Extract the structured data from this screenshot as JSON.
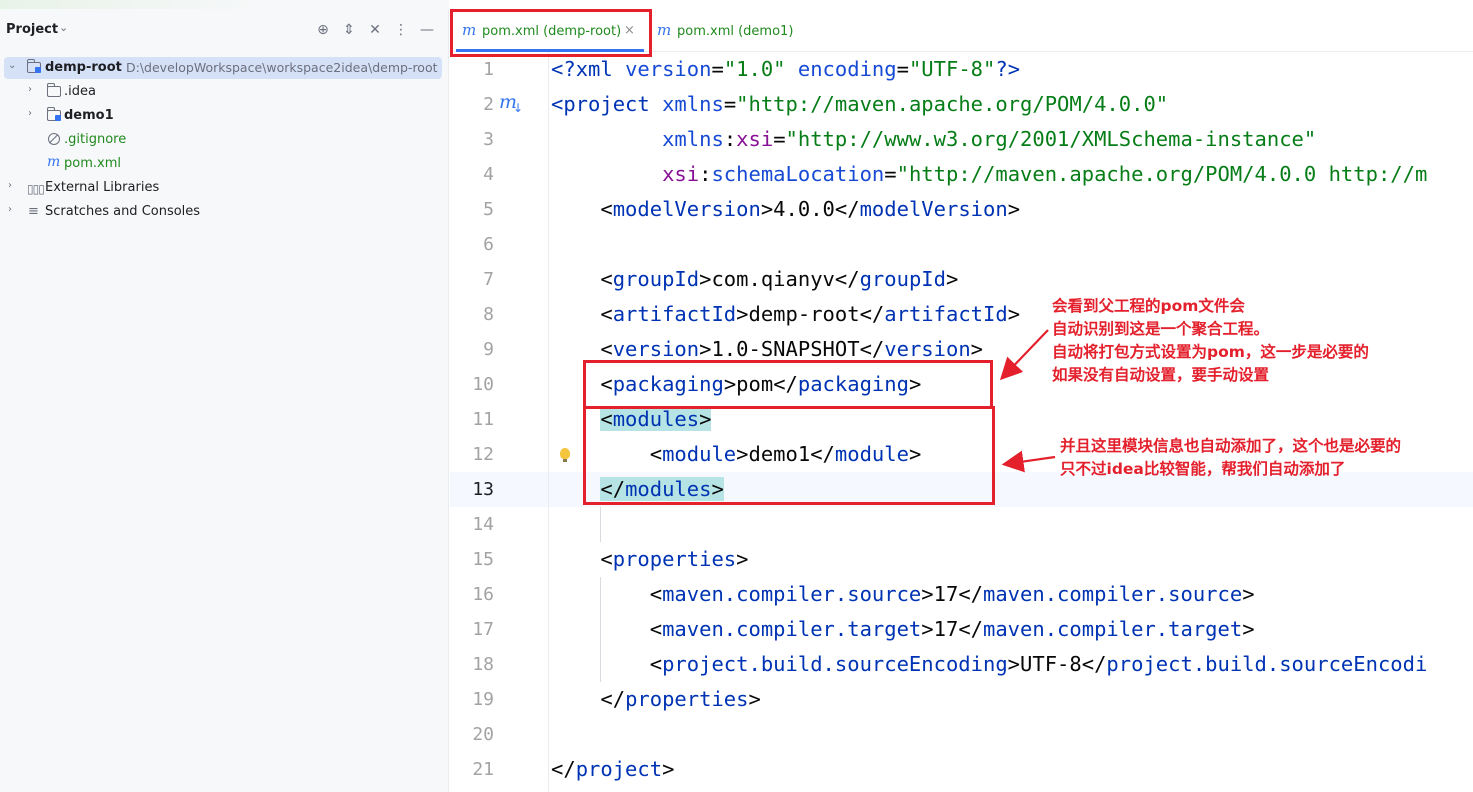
{
  "colors": {
    "annotation_red": "#e3202c",
    "maven_blue": "#3574f0",
    "file_green": "#218a1f",
    "xml_tag": "#0033b3",
    "xml_attr_ns": "#871094",
    "xml_string": "#067d17",
    "selection_bg": "#d5e1f7",
    "highlight_bg": "#b6e3e3"
  },
  "sidebar": {
    "title": "Project",
    "tools": [
      "locate-icon",
      "expand-icon",
      "collapse-icon",
      "more-icon",
      "minimize-icon"
    ],
    "tree": [
      {
        "label": "demp-root",
        "path": "D:\\developWorkspace\\workspace2idea\\demp-root",
        "icon": "module-folder-icon",
        "expanded": true
      },
      {
        "label": ".idea",
        "icon": "folder-icon",
        "expanded": false
      },
      {
        "label": "demo1",
        "icon": "module-folder-icon",
        "expanded": false
      },
      {
        "label": ".gitignore",
        "icon": "ignore-file-icon"
      },
      {
        "label": "pom.xml",
        "icon": "maven-file-icon"
      },
      {
        "label": "External Libraries",
        "icon": "library-icon",
        "expanded": false
      },
      {
        "label": "Scratches and Consoles",
        "icon": "scratches-icon",
        "expanded": false
      }
    ]
  },
  "tabs": [
    {
      "label": "pom.xml (demp-root)",
      "close": "×",
      "active": true
    },
    {
      "label": "pom.xml (demo1)",
      "active": false
    }
  ],
  "editor": {
    "current_line": 13,
    "line_numbers": [
      "1",
      "2",
      "3",
      "4",
      "5",
      "6",
      "7",
      "8",
      "9",
      "10",
      "11",
      "12",
      "13",
      "14",
      "15",
      "16",
      "17",
      "18",
      "19",
      "20",
      "21"
    ],
    "code": {
      "l1": {
        "open": "<?",
        "xml": "xml",
        "v": "version",
        "eq1": "=",
        "vv": "\"1.0\"",
        "e": "encoding",
        "eq2": "=",
        "ev": "\"UTF-8\"",
        "close": "?>"
      },
      "l2": {
        "open": "<",
        "name": "project",
        "attr": "xmlns",
        "eq": "=",
        "val": "\"http://maven.apache.org/POM/4.0.0\""
      },
      "l3": {
        "a1": "xmlns",
        "colon": ":",
        "a2": "xsi",
        "eq": "=",
        "val": "\"http://www.w3.org/2001/XMLSchema-instance\""
      },
      "l4": {
        "a1": "xsi",
        "colon": ":",
        "a2": "schemaLocation",
        "eq": "=",
        "val": "\"http://maven.apache.org/POM/4.0.0 http://m"
      },
      "l5": {
        "name": "modelVersion",
        "text": "4.0.0"
      },
      "l7": {
        "name": "groupId",
        "text": "com.qianyv"
      },
      "l8": {
        "name": "artifactId",
        "text": "demp-root"
      },
      "l9": {
        "name": "version",
        "text": "1.0-SNAPSHOT"
      },
      "l10": {
        "name": "packaging",
        "text": "pom"
      },
      "l11": {
        "name": "modules"
      },
      "l12": {
        "name": "module",
        "text": "demo1"
      },
      "l13": {
        "name": "modules"
      },
      "l15": {
        "name": "properties"
      },
      "l16": {
        "name": "maven.compiler.source",
        "text": "17"
      },
      "l17": {
        "name": "maven.compiler.target",
        "text": "17"
      },
      "l18": {
        "name": "project.build.sourceEncoding",
        "text": "UTF-8",
        "close_partial": "project.build.sourceEncodi"
      },
      "l19": {
        "name": "properties"
      },
      "l21": {
        "name": "project"
      }
    }
  },
  "annotations": {
    "note1": [
      "会看到父工程的pom文件会",
      "自动识别到这是一个聚合工程。",
      "自动将打包方式设置为pom，这一步是必要的",
      "如果没有自动设置，要手动设置"
    ],
    "note2": [
      "并且这里模块信息也自动添加了，这个也是必要的",
      "只不过idea比较智能，帮我们自动添加了"
    ]
  }
}
